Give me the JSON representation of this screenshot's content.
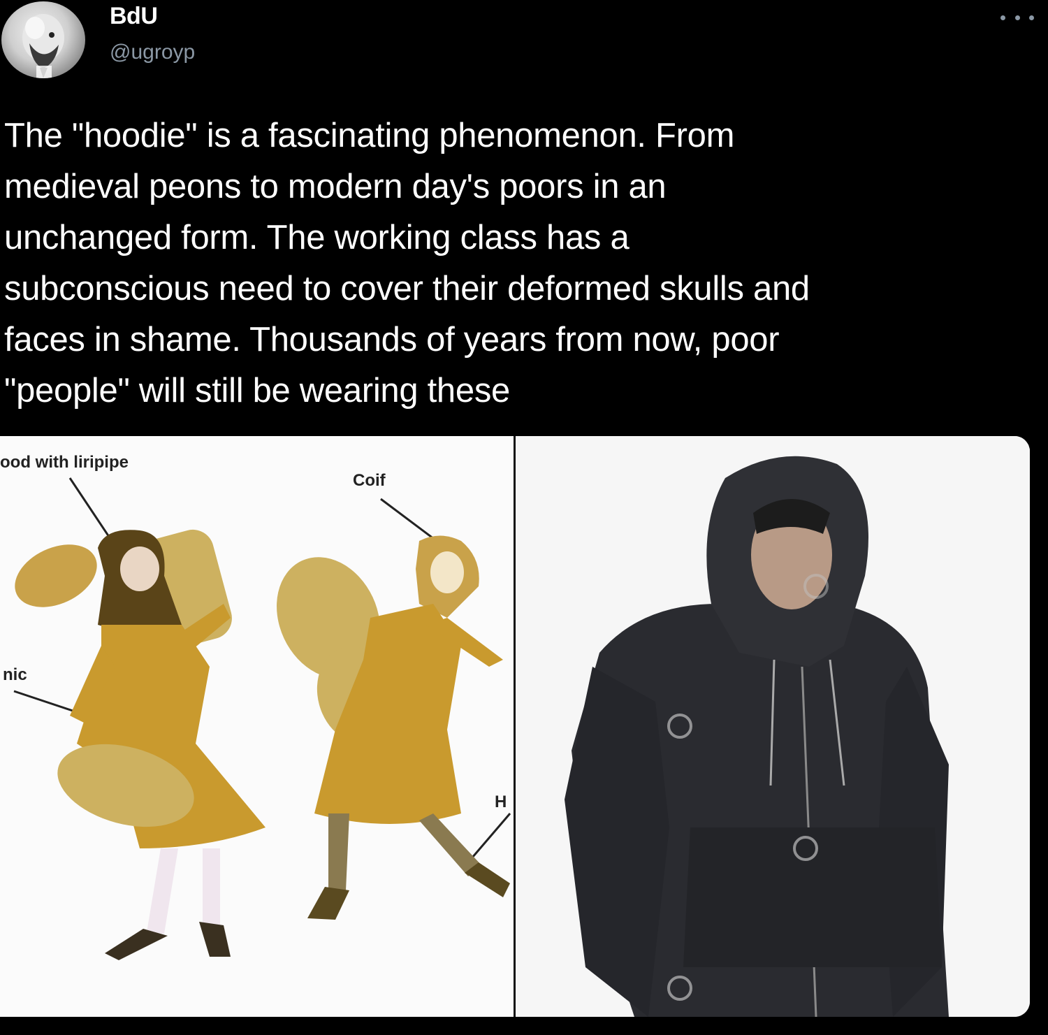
{
  "tweet": {
    "display_name": "BdU",
    "handle": "@ugroyp",
    "text": "The \"hoodie\" is a fascinating phenomenon. From\nmedieval peons to modern day's poors in an\nunchanged form. The working class has a\nsubconscious need to cover their deformed skulls and\nfaces in shame. Thousands of years from now, poor\n\"people\" will still be wearing these"
  },
  "media": {
    "left_panel_labels": {
      "liripipe": "ood with liripipe",
      "coif": "Coif",
      "tunic": "nic",
      "hose": "H"
    }
  },
  "icons": {
    "more": "more-options-icon"
  },
  "colors": {
    "background": "#000000",
    "text": "#ffffff",
    "secondary_text": "#8b98a5",
    "tunic": "#c99a2e",
    "hood": "#5a4418",
    "hoodie": "#2a2b30"
  }
}
